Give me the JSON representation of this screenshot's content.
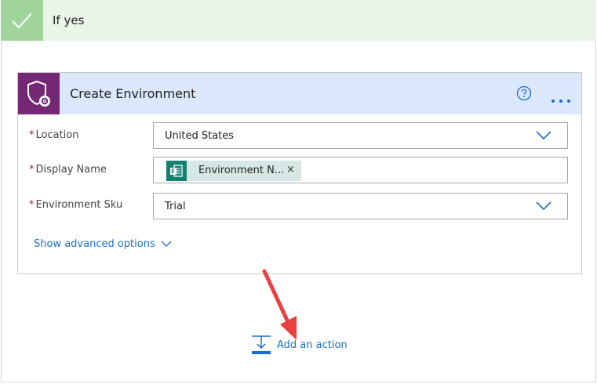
{
  "branch": {
    "title": "If yes"
  },
  "action_card": {
    "title": "Create Environment",
    "icon": "shield-gear-icon",
    "help_icon": "help-circle-icon",
    "more_icon": "ellipsis-icon"
  },
  "fields": {
    "location": {
      "required_mark": "*",
      "label": "Location",
      "value": "United States"
    },
    "display_name": {
      "required_mark": "*",
      "label": "Display Name",
      "token_label": "Environment N...",
      "token_close": "×"
    },
    "sku": {
      "required_mark": "*",
      "label": "Environment Sku",
      "value": "Trial"
    }
  },
  "advanced_options": {
    "label": "Show advanced options"
  },
  "add_action": {
    "label": "Add an action"
  },
  "colors": {
    "branch_header": "#e8f5e7",
    "branch_check": "#9fd39a",
    "card_header": "#dbe8fc",
    "card_icon": "#742774",
    "link": "#1a6fc9",
    "token": "#d5e8e5",
    "token_icon": "#16806f",
    "annotation_arrow": "#e8413f"
  }
}
